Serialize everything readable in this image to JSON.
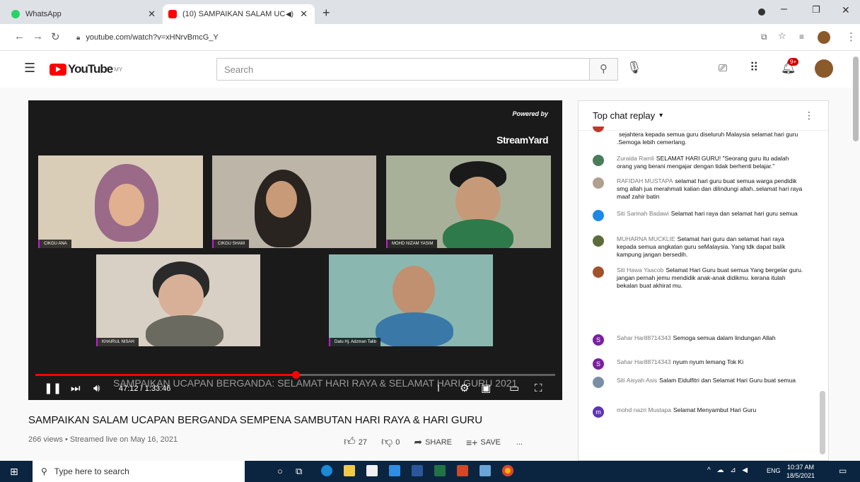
{
  "browser": {
    "tabs": [
      {
        "title": "WhatsApp",
        "color": "#25d366"
      },
      {
        "title": "(10) SAMPAIKAN SALAM UC",
        "color": "#ff0000"
      }
    ],
    "url": "youtube.com/watch?v=xHNrvBmcG_Y"
  },
  "youtube": {
    "region": "MY",
    "search_placeholder": "Search",
    "notification_count": "9+"
  },
  "video": {
    "powered_by": "Powered by",
    "brand": "StreamYard",
    "participants": [
      "CIKGU ANA",
      "CIKGU SHAM",
      "MOHD NIZAM YASIM",
      "KHAIRUL NISAH",
      "Datu Hj. Adzman Talib"
    ],
    "time": "47:12 / 1:33:46",
    "progress": 0.5,
    "overlay_text": "SAMPAIKAN UCAPAN BERGANDA: SELAMAT HARI RAYA & SELAMAT HARI GURU 2021",
    "title": "SAMPAIKAN SALAM UCAPAN BERGANDA SEMPENA SAMBUTAN HARI RAYA & HARI GURU",
    "meta": "266 views • Streamed live on May 16, 2021",
    "likes": "27",
    "dislikes": "0",
    "share": "SHARE",
    "save": "SAVE",
    "more": "..."
  },
  "chat": {
    "header": "Top chat replay",
    "messages": [
      {
        "author": "",
        "text": "sejahtera kepada semua guru diseluruh Malaysia selamat hari guru .Semoga lebih cemerlang.",
        "color": "#c0392b"
      },
      {
        "author": "Zuraida Ramli",
        "text": "SELAMAT HARI GURU! \"Seorang guru itu adalah orang yang berani mengajar dengan tidak berhenti belajar.\"",
        "color": "#4a7c59"
      },
      {
        "author": "RAFIDAH MUSTAPA",
        "text": "selamat hari guru buat semua warga pendidik smg allah jua merahmati kalian dan dilindungi allah..selamat hari raya maaf zahir batin",
        "color": "#b0a090"
      },
      {
        "author": "Siti Sarinah Badawi",
        "text": "Selamat hari raya dan selamat hari guru semua",
        "color": "#1e88e5"
      },
      {
        "author": "MUHARNA MUCKLIE",
        "text": "Selamat hari guru dan selamat hari raya kepada semua angkatan guru seMalaysia. Yang tdk dapat balik kampung jangan bersedih.",
        "color": "#5d6b3a"
      },
      {
        "author": "Siti Hawa Yaacob",
        "text": "Selamat Hari Guru buat semua Yang bergelar guru. jangan pernah jemu mendidik anak-anak didikmu. kerana itulah bekalan buat akhirat mu.",
        "color": "#a0522d"
      },
      {
        "author": "Sahar Har88714343",
        "text": "Semoga semua dalam lindungan Allah",
        "color": "#7b1fa2",
        "initial": "S"
      },
      {
        "author": "Sahar Har88714343",
        "text": "nyum nyum lemang Tok Ki",
        "color": "#7b1fa2",
        "initial": "S"
      },
      {
        "author": "Siti Aisyah Asis",
        "text": "Salam Eidulfitri dan Selamat Hari Guru buat semua",
        "color": "#7a8fa6"
      },
      {
        "author": "mohd nazri Mustapa",
        "text": "Selamat Menyambut Hari Guru",
        "color": "#5e35b1",
        "initial": "m"
      }
    ]
  },
  "taskbar": {
    "search_placeholder": "Type here to search",
    "lang": "ENG",
    "time": "10:37 AM",
    "date": "18/5/2021"
  }
}
